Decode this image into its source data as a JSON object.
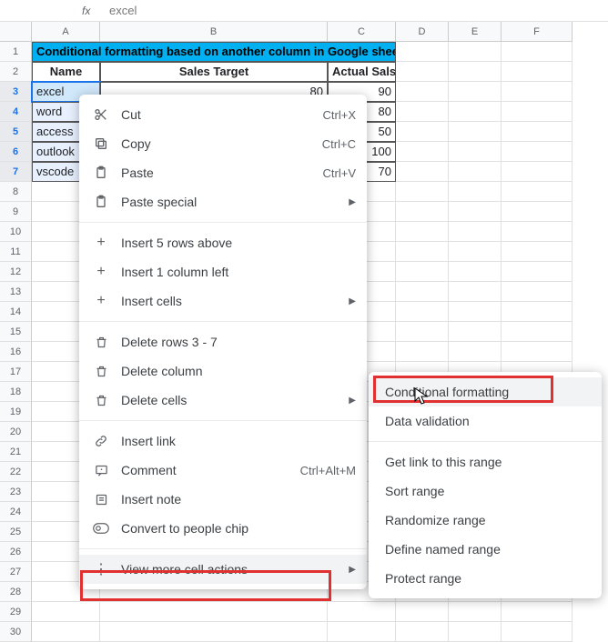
{
  "formula_bar": {
    "name_box": "",
    "fx": "fx",
    "value": "excel"
  },
  "columns": [
    "A",
    "B",
    "C",
    "D",
    "E",
    "F"
  ],
  "col_widths": [
    "cA",
    "cB",
    "cC",
    "cD",
    "cE",
    "cF"
  ],
  "row_count": 30,
  "title": "Conditional formatting based on another column in Google sheets",
  "headers": {
    "name": "Name",
    "sales_target": "Sales Target",
    "actual": "Actual Salse"
  },
  "rows": [
    {
      "name": "excel",
      "target": "80",
      "actual": "90"
    },
    {
      "name": "word",
      "target": "",
      "actual": "80"
    },
    {
      "name": "access",
      "target": "",
      "actual": "50"
    },
    {
      "name": "outlook",
      "target": "",
      "actual": "100"
    },
    {
      "name": "vscode",
      "target": "",
      "actual": "70"
    }
  ],
  "context_menu": {
    "cut": {
      "label": "Cut",
      "shortcut": "Ctrl+X"
    },
    "copy": {
      "label": "Copy",
      "shortcut": "Ctrl+C"
    },
    "paste": {
      "label": "Paste",
      "shortcut": "Ctrl+V"
    },
    "paste_special": {
      "label": "Paste special"
    },
    "insert_rows": {
      "label": "Insert 5 rows above"
    },
    "insert_col": {
      "label": "Insert 1 column left"
    },
    "insert_cells": {
      "label": "Insert cells"
    },
    "delete_rows": {
      "label": "Delete rows 3 - 7"
    },
    "delete_col": {
      "label": "Delete column"
    },
    "delete_cells": {
      "label": "Delete cells"
    },
    "insert_link": {
      "label": "Insert link"
    },
    "comment": {
      "label": "Comment",
      "shortcut": "Ctrl+Alt+M"
    },
    "insert_note": {
      "label": "Insert note"
    },
    "people_chip": {
      "label": "Convert to people chip"
    },
    "more": {
      "label": "View more cell actions"
    }
  },
  "submenu": {
    "cond_format": "Conditional formatting",
    "data_validation": "Data validation",
    "get_link": "Get link to this range",
    "sort_range": "Sort range",
    "randomize": "Randomize range",
    "named_range": "Define named range",
    "protect": "Protect range"
  }
}
